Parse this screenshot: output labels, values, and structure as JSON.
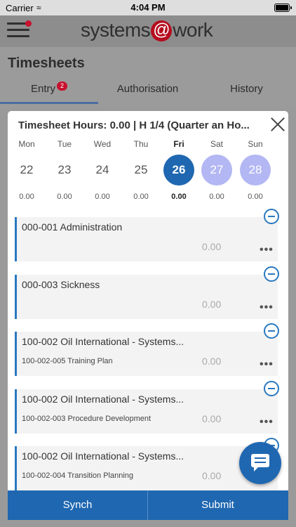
{
  "status_bar": {
    "carrier": "Carrier",
    "time": "4:04 PM"
  },
  "app": {
    "logo_left": "systems",
    "logo_at": "@",
    "logo_right": "work"
  },
  "page": {
    "title": "Timesheets"
  },
  "tabs": [
    {
      "label": "Entry",
      "badge": "2",
      "active": true
    },
    {
      "label": "Authorisation"
    },
    {
      "label": "History"
    }
  ],
  "modal": {
    "title": "Timesheet Hours: 0.00 | H 1/4 (Quarter an Ho...",
    "days": [
      {
        "name": "Mon",
        "date": "22",
        "hours": "0.00"
      },
      {
        "name": "Tue",
        "date": "23",
        "hours": "0.00"
      },
      {
        "name": "Wed",
        "date": "24",
        "hours": "0.00"
      },
      {
        "name": "Thu",
        "date": "25",
        "hours": "0.00"
      },
      {
        "name": "Fri",
        "date": "26",
        "hours": "0.00",
        "selected": true
      },
      {
        "name": "Sat",
        "date": "27",
        "hours": "0.00",
        "weekend": true
      },
      {
        "name": "Sun",
        "date": "28",
        "hours": "0.00",
        "weekend": true
      }
    ],
    "entries": [
      {
        "title": "000-001 Administration",
        "subtitle": "",
        "hours": "0.00"
      },
      {
        "title": "000-003 Sickness",
        "subtitle": "",
        "hours": "0.00"
      },
      {
        "title": "100-002 Oil International - Systems...",
        "subtitle": "100-002-005 Training Plan",
        "hours": "0.00"
      },
      {
        "title": "100-002 Oil International - Systems...",
        "subtitle": "100-002-003 Procedure Development",
        "hours": "0.00"
      },
      {
        "title": "100-002 Oil International - Systems...",
        "subtitle": "100-002-004 Transition Planning",
        "hours": "0.00"
      }
    ],
    "more_glyph": "•••"
  },
  "footer": {
    "synch_label": "Synch",
    "submit_label": "Submit"
  },
  "colors": {
    "primary": "#1f67b1",
    "accent_red": "#c8102e",
    "weekend": "#b3b7f3"
  }
}
